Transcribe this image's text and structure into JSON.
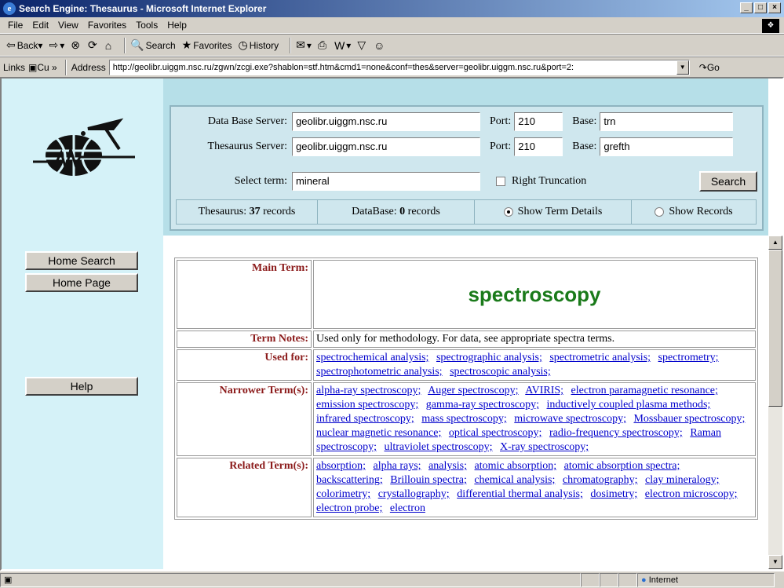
{
  "window": {
    "title": "Search Engine: Thesaurus - Microsoft Internet Explorer"
  },
  "menu": [
    "File",
    "Edit",
    "View",
    "Favorites",
    "Tools",
    "Help"
  ],
  "toolbar": {
    "back": "Back",
    "search": "Search",
    "favorites": "Favorites",
    "history": "History"
  },
  "address": {
    "links_label": "Links",
    "links_item": "Cu",
    "address_label": "Address",
    "url": "http://geolibr.uiggm.nsc.ru/zgwn/zcgi.exe?shablon=stf.htm&cmd1=none&conf=thes&server=geolibr.uiggm.nsc.ru&port=2:",
    "go": "Go"
  },
  "sidebar": {
    "home_search": "Home Search",
    "home_page": "Home Page",
    "help": "Help"
  },
  "form": {
    "db_server_label": "Data Base Server:",
    "db_server_value": "geolibr.uiggm.nsc.ru",
    "port_label": "Port:",
    "db_port_value": "210",
    "base_label": "Base:",
    "db_base_value": "trn",
    "thes_server_label": "Thesaurus Server:",
    "thes_server_value": "geolibr.uiggm.nsc.ru",
    "thes_port_value": "210",
    "thes_base_value": "grefth",
    "select_term_label": "Select term:",
    "select_term_value": "mineral",
    "right_truncation": "Right Truncation",
    "search_button": "Search",
    "thesaurus_label": "Thesaurus:",
    "thesaurus_count": "37",
    "records_word": "records",
    "database_label": "DataBase:",
    "database_count": "0",
    "show_term_details": "Show Term Details",
    "show_records": "Show Records"
  },
  "term": {
    "main_term_label": "Main Term:",
    "main_term": "spectroscopy",
    "notes_label": "Term Notes:",
    "notes": "Used only for methodology. For data, see appropriate spectra terms.",
    "used_for_label": "Used for:",
    "used_for": [
      "spectrochemical analysis;",
      "spectrographic analysis;",
      "spectrometric analysis;",
      "spectrometry;",
      "spectrophotometric analysis;",
      "spectroscopic analysis;"
    ],
    "narrower_label": "Narrower Term(s):",
    "narrower": [
      "alpha-ray spectroscopy;",
      "Auger spectroscopy;",
      "AVIRIS;",
      "electron paramagnetic resonance;",
      "emission spectroscopy;",
      "gamma-ray spectroscopy;",
      "inductively coupled plasma methods;",
      "infrared spectroscopy;",
      "mass spectroscopy;",
      "microwave spectroscopy;",
      "Mossbauer spectroscopy;",
      "nuclear magnetic resonance;",
      "optical spectroscopy;",
      "radio-frequency spectroscopy;",
      "Raman spectroscopy;",
      "ultraviolet spectroscopy;",
      "X-ray spectroscopy;"
    ],
    "related_label": "Related Term(s):",
    "related": [
      "absorption;",
      "alpha rays;",
      "analysis;",
      "atomic absorption;",
      "atomic absorption spectra;",
      "backscattering;",
      "Brillouin spectra;",
      "chemical analysis;",
      "chromatography;",
      "clay mineralogy;",
      "colorimetry;",
      "crystallography;",
      "differential thermal analysis;",
      "dosimetry;",
      "electron microscopy;",
      "electron probe;",
      "electron"
    ]
  },
  "status": {
    "zone": "Internet"
  }
}
